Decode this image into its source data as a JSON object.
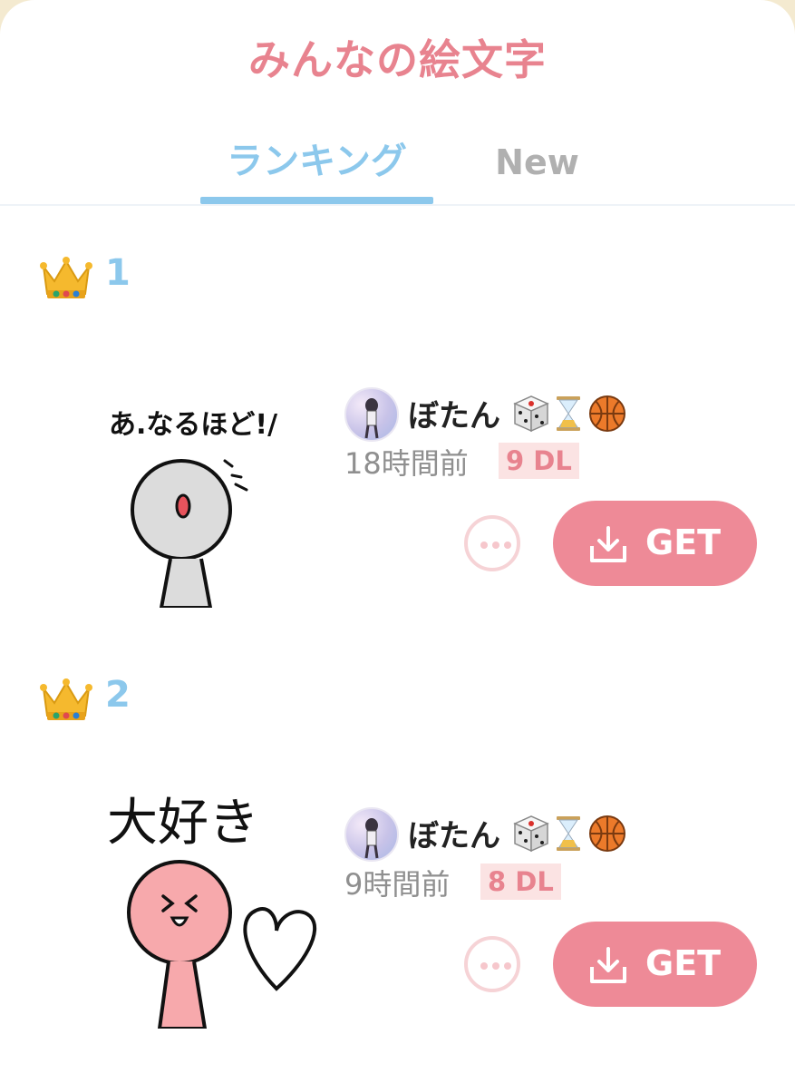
{
  "header": {
    "title": "みんなの絵文字"
  },
  "tabs": [
    {
      "label": "ランキング",
      "active": true
    },
    {
      "label": "New",
      "active": false
    }
  ],
  "accent_color": "#ee8a97",
  "tab_accent_color": "#8cc8ec",
  "rankings": [
    {
      "rank": "1",
      "rank_icon": "crown-icon",
      "sticker_text": "あ.なるほど!/",
      "author": {
        "name": "ぼたん",
        "emojis": [
          "dice-icon",
          "hourglass-icon",
          "basketball-icon"
        ]
      },
      "time": "18時間前",
      "downloads": "9 DL",
      "get_label": "GET"
    },
    {
      "rank": "2",
      "rank_icon": "crown-icon",
      "sticker_text": "大好き",
      "author": {
        "name": "ぼたん",
        "emojis": [
          "dice-icon",
          "hourglass-icon",
          "basketball-icon"
        ]
      },
      "time": "9時間前",
      "downloads": "8 DL",
      "get_label": "GET"
    }
  ]
}
